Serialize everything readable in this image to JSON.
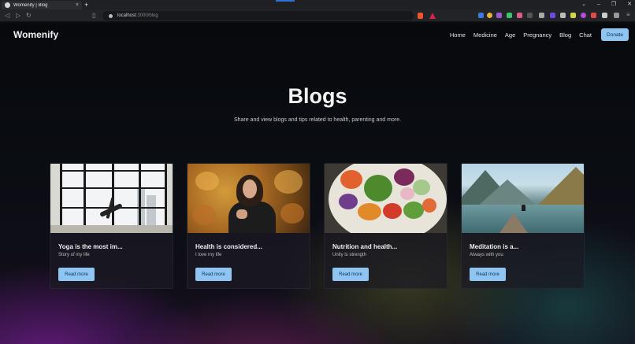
{
  "browser": {
    "tab_title": "Womenify | Blog",
    "close_glyph": "×",
    "new_tab_glyph": "+",
    "url_host": "localhost",
    "url_path": ":3000/blog",
    "window_controls": [
      "⌄",
      "–",
      "❐",
      "✕"
    ]
  },
  "site": {
    "brand": "Womenify",
    "nav": [
      "Home",
      "Medicine",
      "Age",
      "Pregnancy",
      "Blog",
      "Chat"
    ],
    "donate_label": "Donate"
  },
  "hero": {
    "title": "Blogs",
    "subtitle": "Share and view blogs and tips related to health, parenting and more."
  },
  "cards": [
    {
      "title": "Yoga is the most im...",
      "subtitle": "Story of my life",
      "button": "Read more",
      "image": "yoga-photo"
    },
    {
      "title": "Health is considered...",
      "subtitle": "I love my life",
      "button": "Read more",
      "image": "autumn-woman-photo"
    },
    {
      "title": "Nutrition and health...",
      "subtitle": "Unity is strength",
      "button": "Read more",
      "image": "salad-photo"
    },
    {
      "title": "Meditation is a...",
      "subtitle": "Always with you",
      "button": "Read more",
      "image": "lake-photo"
    }
  ],
  "colors": {
    "accent": "#8ec5f2",
    "background": "#0b0d10"
  }
}
